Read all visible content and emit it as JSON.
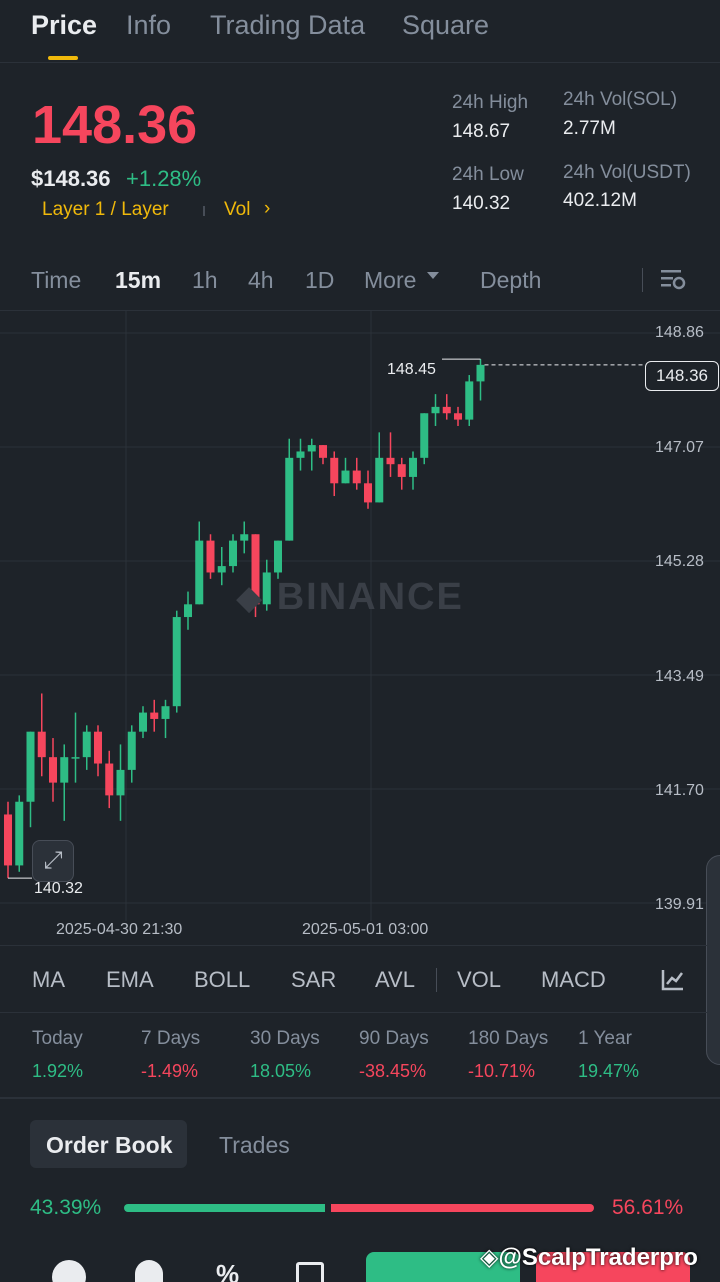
{
  "tabs": [
    "Price",
    "Info",
    "Trading Data",
    "Square"
  ],
  "header": {
    "price": "148.36",
    "usd_price": "$148.36",
    "change_pct": "+1.28%",
    "tag": "Layer 1 / Layer",
    "vol_link": "Vol",
    "stats": {
      "high_label": "24h High",
      "high_value": "148.67",
      "low_label": "24h Low",
      "low_value": "140.32",
      "vol_sol_label": "24h Vol(SOL)",
      "vol_sol_value": "2.77M",
      "vol_usdt_label": "24h Vol(USDT)",
      "vol_usdt_value": "402.12M"
    }
  },
  "timeframes": [
    "Time",
    "15m",
    "1h",
    "4h",
    "1D",
    "More",
    "Depth"
  ],
  "active_timeframe": "15m",
  "chart": {
    "watermark": "BINANCE",
    "high_marker": "148.45",
    "low_marker": "140.32",
    "last_price_tag": "148.36"
  },
  "chart_data": {
    "type": "candlestick",
    "ylim": [
      139.91,
      148.86
    ],
    "y_ticks": [
      "148.86",
      "147.07",
      "145.28",
      "143.49",
      "141.70",
      "139.91"
    ],
    "x_ticks": [
      "2025-04-30 21:30",
      "2025-05-01 03:00"
    ],
    "candles": [
      [
        141.3,
        140.5,
        141.5,
        140.3
      ],
      [
        140.5,
        141.5,
        141.6,
        140.4
      ],
      [
        141.5,
        142.6,
        142.6,
        141.1
      ],
      [
        142.6,
        142.2,
        143.2,
        141.9
      ],
      [
        142.2,
        141.8,
        142.5,
        141.5
      ],
      [
        141.8,
        142.2,
        142.4,
        141.2
      ],
      [
        142.2,
        142.2,
        142.9,
        141.8
      ],
      [
        142.2,
        142.6,
        142.7,
        142.0
      ],
      [
        142.6,
        142.1,
        142.7,
        141.9
      ],
      [
        142.1,
        141.6,
        142.3,
        141.4
      ],
      [
        141.6,
        142.0,
        142.4,
        141.2
      ],
      [
        142.0,
        142.6,
        142.7,
        141.8
      ],
      [
        142.6,
        142.9,
        143.0,
        142.5
      ],
      [
        142.9,
        142.8,
        143.1,
        142.6
      ],
      [
        142.8,
        143.0,
        143.1,
        142.5
      ],
      [
        143.0,
        144.4,
        144.5,
        142.9
      ],
      [
        144.4,
        144.6,
        144.8,
        144.2
      ],
      [
        144.6,
        145.6,
        145.9,
        144.6
      ],
      [
        145.6,
        145.1,
        145.7,
        145.0
      ],
      [
        145.1,
        145.2,
        145.5,
        144.9
      ],
      [
        145.2,
        145.6,
        145.7,
        145.1
      ],
      [
        145.6,
        145.7,
        145.9,
        145.4
      ],
      [
        145.7,
        144.6,
        145.7,
        144.4
      ],
      [
        144.6,
        145.1,
        145.3,
        144.5
      ],
      [
        145.1,
        145.6,
        145.6,
        145.0
      ],
      [
        145.6,
        146.9,
        147.2,
        145.6
      ],
      [
        146.9,
        147.0,
        147.2,
        146.7
      ],
      [
        147.0,
        147.1,
        147.2,
        146.7
      ],
      [
        147.1,
        146.9,
        147.1,
        146.8
      ],
      [
        146.9,
        146.5,
        147.0,
        146.3
      ],
      [
        146.5,
        146.7,
        146.9,
        146.5
      ],
      [
        146.7,
        146.5,
        146.9,
        146.4
      ],
      [
        146.5,
        146.2,
        146.7,
        146.1
      ],
      [
        146.2,
        146.9,
        147.3,
        146.2
      ],
      [
        146.9,
        146.8,
        147.3,
        146.6
      ],
      [
        146.8,
        146.6,
        146.9,
        146.4
      ],
      [
        146.6,
        146.9,
        147.0,
        146.4
      ],
      [
        146.9,
        147.6,
        147.6,
        146.8
      ],
      [
        147.6,
        147.7,
        147.9,
        147.4
      ],
      [
        147.7,
        147.6,
        147.9,
        147.5
      ],
      [
        147.6,
        147.5,
        147.7,
        147.4
      ],
      [
        147.5,
        148.1,
        148.2,
        147.4
      ],
      [
        148.1,
        148.36,
        148.45,
        147.8
      ]
    ]
  },
  "indicators": [
    "MA",
    "EMA",
    "BOLL",
    "SAR",
    "AVL",
    "VOL",
    "MACD"
  ],
  "performance": [
    {
      "label": "Today",
      "value": "1.92%",
      "sign": "pos"
    },
    {
      "label": "7 Days",
      "value": "-1.49%",
      "sign": "neg"
    },
    {
      "label": "30 Days",
      "value": "18.05%",
      "sign": "pos"
    },
    {
      "label": "90 Days",
      "value": "-38.45%",
      "sign": "neg"
    },
    {
      "label": "180 Days",
      "value": "-10.71%",
      "sign": "neg"
    },
    {
      "label": "1 Year",
      "value": "19.47%",
      "sign": "pos"
    }
  ],
  "orderbook": {
    "tab_active": "Order Book",
    "tab_other": "Trades",
    "buy_pct": "43.39%",
    "sell_pct": "56.61%",
    "buy_ratio": 0.4339
  },
  "watermark_handle": "@ScalpTraderpro",
  "colors": {
    "up": "#2ebd85",
    "down": "#f6465d",
    "accent": "#f0b90b",
    "bg": "#1e2329"
  }
}
